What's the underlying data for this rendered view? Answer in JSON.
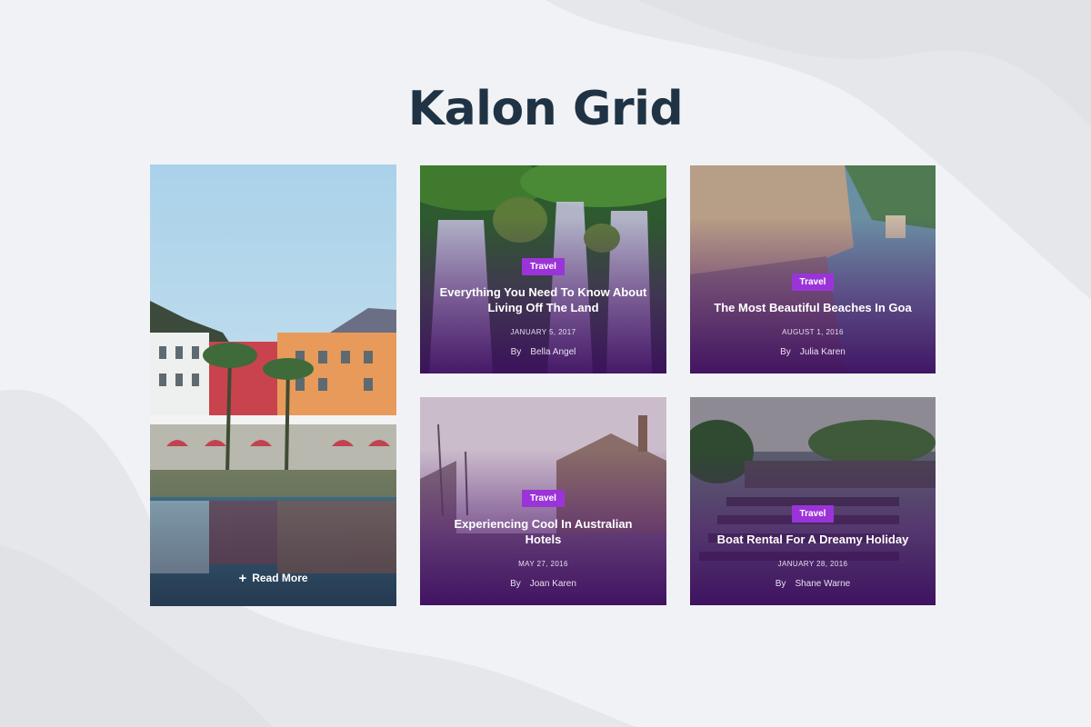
{
  "page": {
    "title": "Kalon Grid"
  },
  "featured": {
    "read_more_label": "Read More",
    "plus_icon": "+"
  },
  "cards": [
    {
      "category": "Travel",
      "title": "Everything You Need To Know About Living Off The Land",
      "date": "JANUARY 5, 2017",
      "by": "By",
      "author": "Bella Angel"
    },
    {
      "category": "Travel",
      "title": "The Most Beautiful Beaches In Goa",
      "date": "AUGUST 1, 2016",
      "by": "By",
      "author": "Julia Karen"
    },
    {
      "category": "Travel",
      "title": "Experiencing Cool In Australian Hotels",
      "date": "MAY 27, 2016",
      "by": "By",
      "author": "Joan Karen"
    },
    {
      "category": "Travel",
      "title": "Boat Rental For A Dreamy Holiday",
      "date": "JANUARY 28, 2016",
      "by": "By",
      "author": "Shane Warne"
    }
  ],
  "colors": {
    "badge": "#9b34d8",
    "title": "#1f3344",
    "background": "#f1f2f5",
    "overlay": "#3c0c5f"
  }
}
